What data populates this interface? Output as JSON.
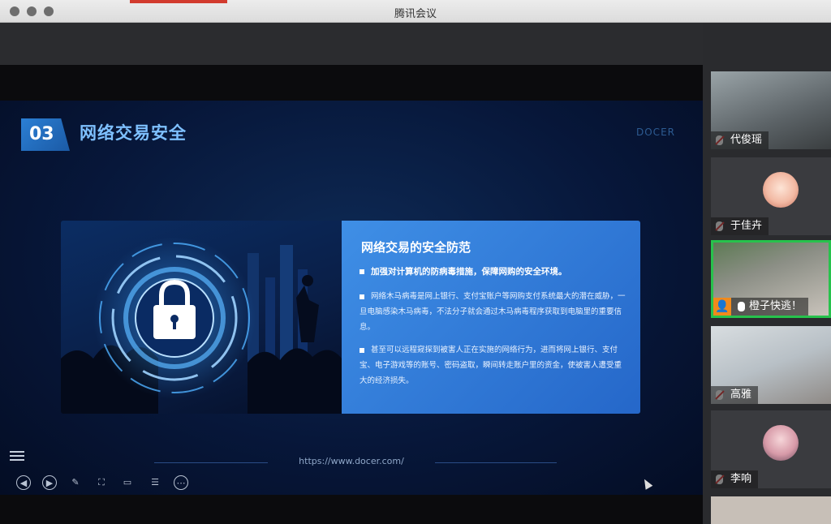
{
  "window": {
    "title": "腾讯会议"
  },
  "slide": {
    "number": "03",
    "title": "网络交易安全",
    "brand": "DOCER",
    "card": {
      "heading": "网络交易的安全防范",
      "bullet1": "加强对计算机的防病毒措施，保障网购的安全环境。",
      "bullet2": "网络木马病毒是网上银行、支付宝账户等网购支付系统最大的潜在威胁，一旦电脑感染木马病毒，不法分子就会通过木马病毒程序获取到电脑里的重要信息。",
      "bullet3": "甚至可以远程窥探到被害人正在实施的网络行为，进而将网上银行、支付宝、电子游戏等的账号、密码盗取，瞬间转走账户里的资金，使被害人遭受重大的经济损失。"
    },
    "url": "https://www.docer.com/"
  },
  "participants": [
    {
      "name": "代俊瑶",
      "muted": true
    },
    {
      "name": "于佳卉",
      "muted": true
    },
    {
      "name": "橙子快逃！",
      "muted": false,
      "speaking": true
    },
    {
      "name": "高雅",
      "muted": true
    },
    {
      "name": "李响",
      "muted": true
    }
  ],
  "icons": {
    "controls": [
      "prev-icon",
      "play-icon",
      "pen-icon",
      "screen-icon",
      "camera-icon",
      "comment-icon",
      "more-icon"
    ]
  },
  "colors": {
    "accent": "#27c24c",
    "slide_blue": "#2b7fd4"
  }
}
